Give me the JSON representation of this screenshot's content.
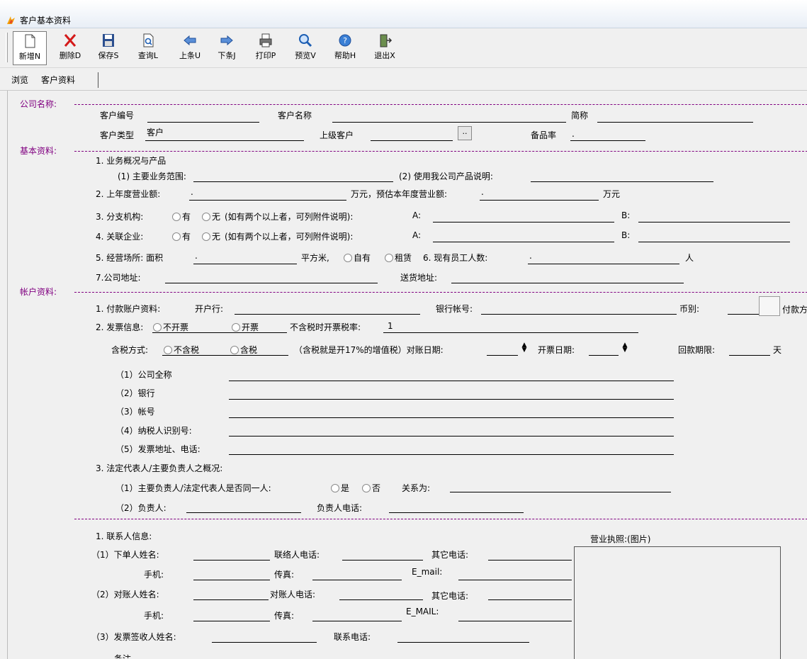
{
  "window": {
    "title": "客户基本资料"
  },
  "toolbar": [
    {
      "label": "新增N",
      "icon": "new-doc-icon"
    },
    {
      "label": "删除D",
      "icon": "delete-x-icon"
    },
    {
      "label": "保存S",
      "icon": "save-icon"
    },
    {
      "label": "查询L",
      "icon": "query-icon"
    },
    {
      "label": "上条U",
      "icon": "left-arrow-icon"
    },
    {
      "label": "下条J",
      "icon": "right-arrow-icon"
    },
    {
      "label": "打印P",
      "icon": "printer-icon"
    },
    {
      "label": "预览V",
      "icon": "magnifier-icon"
    },
    {
      "label": "帮助H",
      "icon": "help-icon"
    },
    {
      "label": "退出X",
      "icon": "exit-door-icon"
    }
  ],
  "tabs": [
    "浏览",
    "客户资料"
  ],
  "sections": {
    "company": "公司名称:",
    "basic": "基本资料:",
    "account": "帐户资料:"
  },
  "company": {
    "code_label": "客户编号",
    "name_label": "客户名称",
    "short_label": "简称",
    "type_label": "客户类型",
    "type_value": "客户",
    "parent_label": "上级客户",
    "browse_btn": "..",
    "stock_rate_label": "备品率",
    "stock_rate_value": "."
  },
  "basic": {
    "q1": "1. 业务概况与产品",
    "q1a": "(1) 主要业务范围:",
    "q1b": "(2) 使用我公司产品说明:",
    "q2": "2. 上年度营业额:",
    "q2_dot": ".",
    "q2_unit": "万元，预估本年度营业额:",
    "q2_dot2": ".",
    "q2_unit2": "万元",
    "q3": "3. 分支机构:",
    "yes": "有",
    "no": "无",
    "note": "(如有两个以上者，可列附件说明):",
    "a_label": "A:",
    "b_label": "B:",
    "q4": "4. 关联企业:",
    "q5": "5. 经营场所: 面积",
    "q5_dot": ".",
    "q5_unit": "平方米,",
    "own": "自有",
    "rent": "租赁",
    "q6": "6. 现有员工人数:",
    "q6_dot": ".",
    "q6_unit": "人",
    "q7": "7.公司地址:",
    "delivery": "送货地址:"
  },
  "account": {
    "q1": "1.  付款账户资料:",
    "bank": "开户行:",
    "bank_no": "银行帐号:",
    "currency": "币别:",
    "pay_cut": "付款方",
    "q2": "2. 发票信息:",
    "no_invoice": "不开票",
    "invoice": "开票",
    "rate_label": "不含税时开票税率:",
    "rate_value": "1",
    "tax_mode": "含税方式:",
    "no_tax": "不含税",
    "with_tax": "含税",
    "tax_note": "（含税就是开17%的增值税）对账日期:",
    "invoice_date": "开票日期:",
    "payback": "回款期限:",
    "day": "天",
    "inv_items": [
      "（1）公司全称",
      "（2）银行",
      "（3）帐号",
      "（4）纳税人识别号:",
      "（5）发票地址、电话:"
    ],
    "q3": "3. 法定代表人/主要负责人之概况:",
    "q3a": "（1）主要负责人/法定代表人是否同一人:",
    "is": "是",
    "not": "否",
    "relation": "关系为:",
    "q3b": "（2）负责人:",
    "q3b_phone": "负责人电话:"
  },
  "contact": {
    "title": "1. 联系人信息:",
    "license": "营业执照:(图片)",
    "order_name": "（1）下单人姓名:",
    "contact_phone": "联络人电话:",
    "other_phone": "其它电话:",
    "mobile": "手机:",
    "fax": "传真:",
    "email": "E_mail:",
    "recon_name": "（2）对账人姓名:",
    "recon_phone": "对账人电话:",
    "other_phone2": "其它电话:",
    "mobile2": "手机:",
    "fax2": "传真:",
    "email2": "E_MAIL:",
    "invoice_recv": "（3）发票签收人姓名:",
    "contact_tel": "联系电话:",
    "remark_cut": "备注"
  }
}
